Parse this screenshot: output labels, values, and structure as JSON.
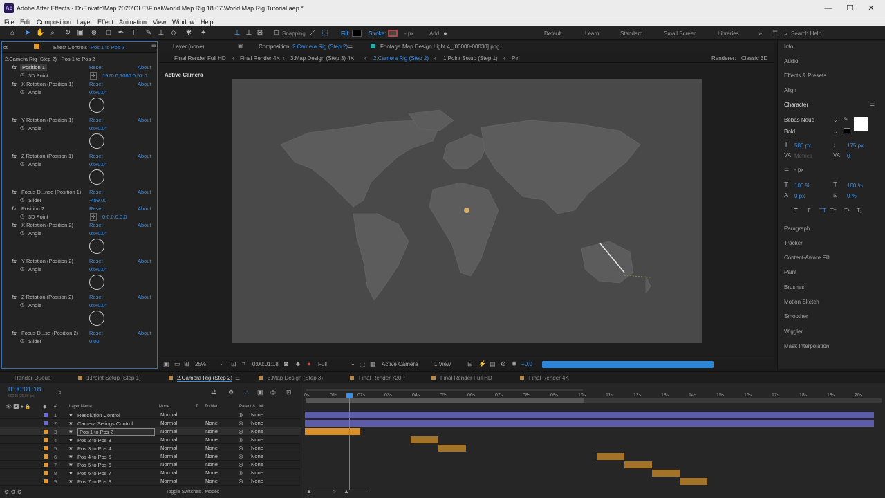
{
  "app": {
    "title": "Adobe After Effects - D:\\Envato\\Map 2020\\OUT\\Final\\World Map Rig 18.07\\World Map Rig Tutorial.aep *",
    "logo": "Ae"
  },
  "menu": [
    "File",
    "Edit",
    "Composition",
    "Layer",
    "Effect",
    "Animation",
    "View",
    "Window",
    "Help"
  ],
  "toolbar": {
    "snapping": "Snapping",
    "fill": "Fill:",
    "stroke": "Stroke:",
    "px": "- px",
    "add": "Add:",
    "workspaces": [
      "Default",
      "Learn",
      "Standard",
      "Small Screen",
      "Libraries"
    ],
    "search": "Search Help"
  },
  "effects": {
    "tab_prefix": "ct",
    "tab_label": "Effect Controls",
    "tab_layer": "Pos 1 to Pos 2",
    "subtitle": "2.Camera Rig (Step 2) - Pos 1 to Pos 2",
    "rows": [
      {
        "name": "Position 1",
        "reset": "Reset",
        "about": "About"
      },
      {
        "name": "3D Point",
        "value": "1920.0,1080.0,57.0"
      },
      {
        "name": "X Rotation (Position 1)",
        "reset": "Reset",
        "about": "About"
      },
      {
        "name": "Angle",
        "value": "0x+0.0°"
      },
      {
        "name": "Y Rotation (Position 1)",
        "reset": "Reset",
        "about": "About"
      },
      {
        "name": "Angle",
        "value": "0x+0.0°"
      },
      {
        "name": "Z Rotation (Position 1)",
        "reset": "Reset",
        "about": "About"
      },
      {
        "name": "Angle",
        "value": "0x+0.0°"
      },
      {
        "name": "Focus D...nse (Position 1)",
        "reset": "Reset",
        "about": "About"
      },
      {
        "name": "Slider",
        "value": "-499.00"
      },
      {
        "name": "Position 2",
        "reset": "Reset",
        "about": "About"
      },
      {
        "name": "3D Point",
        "value": "0.0,0.0,0.0"
      },
      {
        "name": "X Rotation (Position 2)",
        "reset": "Reset",
        "about": "About"
      },
      {
        "name": "Angle",
        "value": "0x+0.0°"
      },
      {
        "name": "Y Rotation (Position 2)",
        "reset": "Reset",
        "about": "About"
      },
      {
        "name": "Angle",
        "value": "0x+0.0°"
      },
      {
        "name": "Z Rotation (Position 2)",
        "reset": "Reset",
        "about": "About"
      },
      {
        "name": "Angle",
        "value": "0x+0.0°"
      },
      {
        "name": "Focus D...se (Position 2)",
        "reset": "Reset",
        "about": "About"
      },
      {
        "name": "Slider",
        "value": "0.00"
      }
    ]
  },
  "composition": {
    "layer_tab": "Layer (none)",
    "comp_tab": "Composition",
    "comp_name": "2.Camera Rig (Step 2)",
    "footage_tab": "Footage",
    "footage_name": "Map Design Light 4_[00000-00030].png",
    "flow": [
      "Final Render Full HD",
      "Final Render 4K",
      "3.Map Design (Step 3) 4K",
      "2.Camera Rig (Step 2)",
      "1.Point Setup (Step 1)",
      "Pin"
    ],
    "renderer_label": "Renderer:",
    "renderer": "Classic 3D",
    "active_camera": "Active Camera",
    "viewer_controls": {
      "zoom": "25%",
      "time": "0:00:01:18",
      "resolution": "Full",
      "camera": "Active Camera",
      "views": "1 View",
      "exposure": "+0.0"
    }
  },
  "right_panel": {
    "items_top": [
      "Info",
      "Audio",
      "Effects & Presets",
      "Align"
    ],
    "character": "Character",
    "font": "Bebas Neue",
    "style": "Bold",
    "size": "580 px",
    "leading": "175 px",
    "kerning": "Metrics",
    "tracking": "0",
    "stroke_px": "- px",
    "vscale": "100 %",
    "hscale": "100 %",
    "baseline": "0 px",
    "tsume": "0 %",
    "items_bottom": [
      "Paragraph",
      "Tracker",
      "Content-Aware Fill",
      "Paint",
      "Brushes",
      "Motion Sketch",
      "Smoother",
      "Wiggler",
      "Mask Interpolation"
    ]
  },
  "timeline_tabs": [
    {
      "label": "Render Queue",
      "color": ""
    },
    {
      "label": "1.Point Setup (Step 1)",
      "color": "#b58a4a"
    },
    {
      "label": "2.Camera Rig (Step 2)",
      "color": "#b58a4a"
    },
    {
      "label": "3.Map Design (Step 3)",
      "color": "#b58a4a"
    },
    {
      "label": "Final Render 720P",
      "color": "#b58a4a"
    },
    {
      "label": "Final Render Full HD",
      "color": "#b58a4a"
    },
    {
      "label": "Final Render 4K",
      "color": "#b58a4a"
    }
  ],
  "timeline": {
    "timecode": "0:00:01:18",
    "fps": "00048 (25.00 fps)",
    "headers": {
      "layer": "Layer Name",
      "mode": "Mode",
      "t": "T",
      "trkmat": "TrkMat",
      "parent": "Parent & Link"
    },
    "ruler": [
      "0s",
      "01s",
      "02s",
      "03s",
      "04s",
      "05s",
      "06s",
      "07s",
      "08s",
      "09s",
      "10s",
      "11s",
      "12s",
      "13s",
      "14s",
      "15s",
      "16s",
      "17s",
      "18s",
      "19s",
      "20s"
    ],
    "layers": [
      {
        "num": "1",
        "name": "Resolution Control",
        "color": "#6b6bd6",
        "mode": "Normal",
        "trkmat": "",
        "parent": "None"
      },
      {
        "num": "2",
        "name": "Camera Setings Control",
        "color": "#6b6bd6",
        "mode": "Normal",
        "trkmat": "None",
        "parent": "None"
      },
      {
        "num": "3",
        "name": "Pos 1 to Pos 2",
        "color": "#e39a2a",
        "mode": "Normal",
        "trkmat": "None",
        "parent": "None"
      },
      {
        "num": "4",
        "name": "Pos 2 to Pos 3",
        "color": "#e39a2a",
        "mode": "Normal",
        "trkmat": "None",
        "parent": "None"
      },
      {
        "num": "5",
        "name": "Pos 3 to Pos 4",
        "color": "#e39a2a",
        "mode": "Normal",
        "trkmat": "None",
        "parent": "None"
      },
      {
        "num": "6",
        "name": "Pos 4 to Pos 5",
        "color": "#e39a2a",
        "mode": "Normal",
        "trkmat": "None",
        "parent": "None"
      },
      {
        "num": "7",
        "name": "Pos 5 to Pos 6",
        "color": "#e39a2a",
        "mode": "Normal",
        "trkmat": "None",
        "parent": "None"
      },
      {
        "num": "8",
        "name": "Pos 6 to Pos 7",
        "color": "#e39a2a",
        "mode": "Normal",
        "trkmat": "None",
        "parent": "None"
      },
      {
        "num": "9",
        "name": "Pos 7 to Pos 8",
        "color": "#e39a2a",
        "mode": "Normal",
        "trkmat": "None",
        "parent": "None"
      }
    ],
    "toggle": "Toggle Switches / Modes"
  }
}
